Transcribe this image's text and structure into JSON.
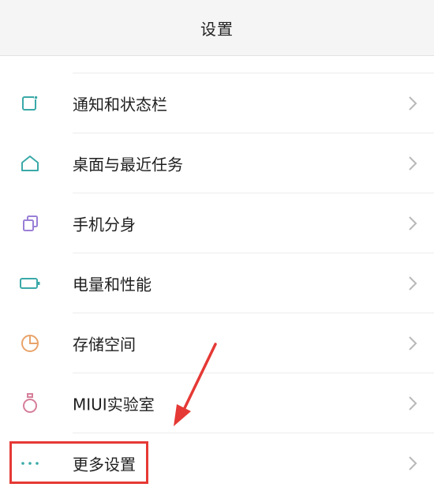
{
  "header": {
    "title": "设置"
  },
  "settings": {
    "items": [
      {
        "label": "通知和状态栏",
        "icon": "notification-icon"
      },
      {
        "label": "桌面与最近任务",
        "icon": "home-icon"
      },
      {
        "label": "手机分身",
        "icon": "clone-icon"
      },
      {
        "label": "电量和性能",
        "icon": "battery-icon"
      },
      {
        "label": "存储空间",
        "icon": "storage-pie-icon"
      },
      {
        "label": "MIUI实验室",
        "icon": "lab-flask-icon"
      },
      {
        "label": "更多设置",
        "icon": "more-dots-icon"
      }
    ]
  },
  "colors": {
    "icon_teal": "#3aa9a8",
    "icon_purple": "#9a7fd6",
    "icon_orange": "#e8a36a",
    "icon_pink": "#d67f9a",
    "highlight_red": "#e53935",
    "chevron_gray": "#b8b8b8"
  }
}
